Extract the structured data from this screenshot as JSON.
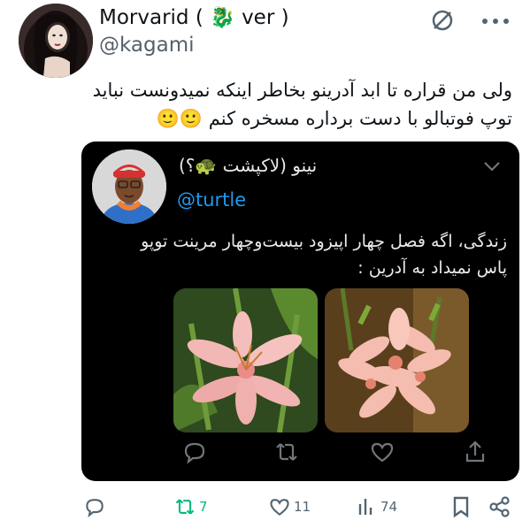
{
  "tweet": {
    "display_name": "Morvarid ( 🐉 ver )",
    "handle": "@kagami",
    "text_line1": "ولی من قراره تا ابد آدرینو بخاطر اینکه نمیدونست نباید",
    "text_line2": "توپ فوتبالو با دست برداره مسخره کنم 🙂🙂"
  },
  "quote": {
    "display_name": "نینو (لاکپشت 🐢؟)",
    "handle": "@turtle",
    "text_line1": "زندگی، اگه فصل چهار اپیزود بیست‌وچهار مرینت توپو",
    "text_line2": "پاس نمیداد به آدرین :"
  },
  "actions": {
    "retweets": "7",
    "likes": "11",
    "views": "74"
  },
  "colors": {
    "accent": "#1d9bf0",
    "retweet_active": "#00ba7c",
    "quote_bg": "#000000"
  }
}
